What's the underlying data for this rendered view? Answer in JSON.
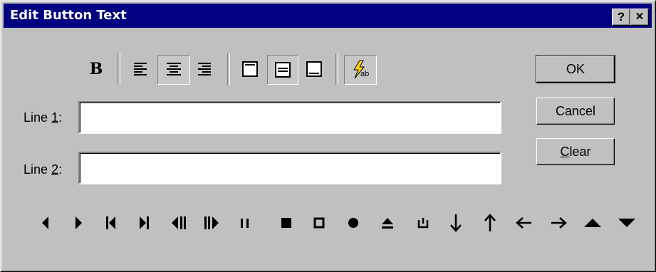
{
  "window": {
    "title": "Edit Button Text",
    "help_label": "?",
    "close_label": "✕"
  },
  "toolbar": {
    "bold_label": "B",
    "items": [
      "bold",
      "align-left",
      "align-center",
      "align-right",
      "valign-top",
      "valign-middle",
      "valign-bottom",
      "special-char"
    ],
    "pressed": [
      "align-center",
      "valign-middle",
      "special-char"
    ]
  },
  "form": {
    "line1_label_prefix": "Line ",
    "line1_label_accel": "1",
    "line1_label_suffix": ":",
    "line1_value": "",
    "line2_label_prefix": "Line ",
    "line2_label_accel": "2",
    "line2_label_suffix": ":",
    "line2_value": ""
  },
  "buttons": {
    "ok": "OK",
    "cancel": "Cancel",
    "clear_accel": "C",
    "clear_rest": "lear"
  },
  "symbols": [
    "triangle-left-icon",
    "triangle-right-icon",
    "skip-back-icon",
    "skip-forward-icon",
    "step-back-icon",
    "step-forward-icon",
    "pause-icon",
    "stop-icon",
    "square-outline-icon",
    "record-icon",
    "eject-icon",
    "power-icon",
    "arrow-down-icon",
    "arrow-up-icon",
    "arrow-left-icon",
    "arrow-right-icon",
    "triangle-up-icon",
    "triangle-down-icon"
  ]
}
